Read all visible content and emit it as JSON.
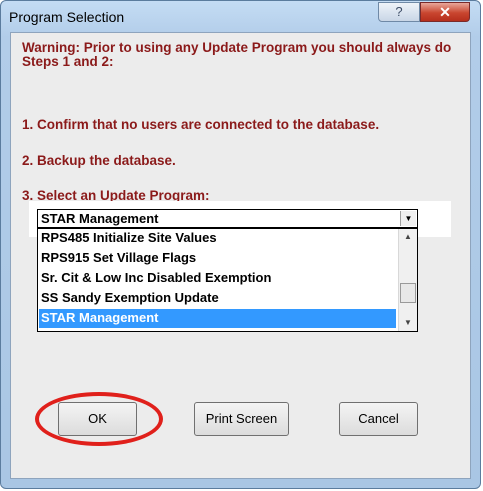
{
  "window": {
    "title": "Program Selection",
    "help_glyph": "?",
    "close_glyph": "✕"
  },
  "instructions": {
    "warning": "Warning: Prior to using any Update Program you should always do Steps 1 and 2:",
    "step1": "1. Confirm that no users are connected to the  database.",
    "step2": "2. Backup the database.",
    "step3": "3. Select an Update Program:"
  },
  "program_select": {
    "selected": "STAR Management",
    "options": [
      "RPS485 Initialize Site Values",
      "RPS915 Set Village Flags",
      "Sr. Cit & Low Inc Disabled Exemption",
      "SS Sandy Exemption Update",
      "STAR Management"
    ],
    "selected_index": 4
  },
  "buttons": {
    "ok": "OK",
    "print_screen": "Print Screen",
    "cancel": "Cancel"
  },
  "colors": {
    "warning_text": "#8b1a1a",
    "selection": "#3399ff",
    "highlight_circle": "#e0201b"
  }
}
